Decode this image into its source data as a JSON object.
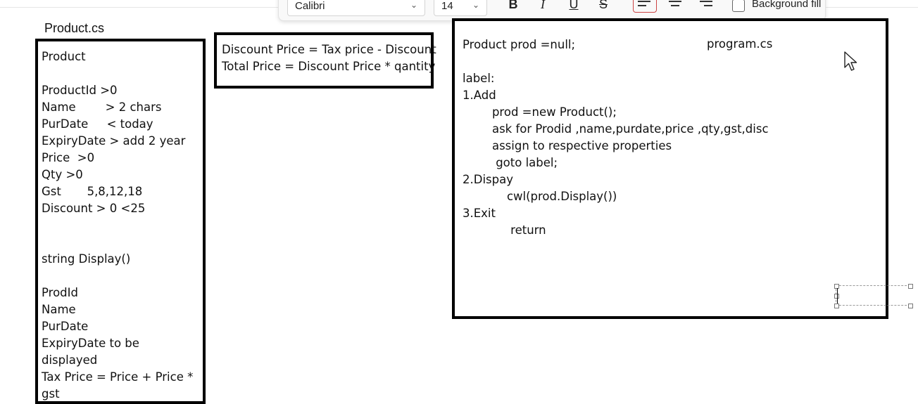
{
  "toolbar": {
    "font_family": "Calibri",
    "font_size": "14",
    "bold_icon": "B",
    "italic_icon": "I",
    "underline_icon": "U",
    "strike_icon": "S",
    "background_fill_label": "Background fill",
    "background_fill_checked": false
  },
  "product_section": {
    "heading": "Product.cs",
    "lines": [
      "Product",
      "",
      "ProductId >0",
      "Name        > 2 chars",
      "PurDate     < today",
      "ExpiryDate > add 2 year",
      "Price  >0",
      "Qty >0",
      "Gst       5,8,12,18",
      "Discount > 0 <25",
      "",
      "",
      "string Display()",
      "",
      "ProdId",
      "Name",
      "PurDate",
      "ExpiryDate to be",
      "displayed",
      "Tax Price = Price + Price *",
      "gst"
    ]
  },
  "discount_section": {
    "lines": [
      "Discount Price = Tax price - Discount",
      "Total Price = Discount Price * qantity"
    ]
  },
  "program_section": {
    "label": "program.cs",
    "lines": [
      "Product prod =null;",
      "",
      "label:",
      "1.Add",
      "        prod =new Product();",
      "        ask for Prodid ,name,purdate,price ,qty,gst,disc",
      "        assign to respective properties",
      "         goto label;",
      "2.Dispay",
      "            cwl(prod.Display())",
      "3.Exit",
      "             return"
    ]
  },
  "icons": {
    "chevron": "chevron-down-icon",
    "cursor": "mouse-pointer-icon"
  },
  "colors": {
    "background": "#ffffff",
    "border": "#000000",
    "toolbar_bg": "#f9f9f9",
    "active_align": "#cc4444"
  }
}
